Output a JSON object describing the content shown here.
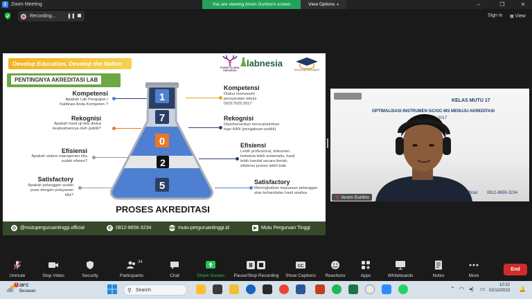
{
  "window": {
    "app_title": "Zoom Meeting",
    "viewing_banner": "You are viewing Anom Guritno's screen",
    "view_options": "View Options"
  },
  "topbar": {
    "recording_label": "Recording...",
    "sign_in": "Sign in",
    "view": "View"
  },
  "slide": {
    "banner": "Develop Education, Develop the Nation",
    "partner_logo_text": "PUMKE GLOBAL INDONESIA",
    "labnesia": "labnesia",
    "mpt_logo_text": "www.perguruantinggi.id",
    "section_title": "PENTINGNYA AKREDITASI LAB",
    "left_items": [
      {
        "title": "Kompetensi",
        "desc": "Apakah Lab Pengujian / Kalibrasi Anda Kompeten ?"
      },
      {
        "title": "Rekognisi",
        "desc": "Apakah hasil uji kita diakui keabsahannya oleh publik?"
      },
      {
        "title": "Efisiensi",
        "desc": "Apakah sistem manajemen kita sudah efisien?"
      },
      {
        "title": "Satisfactory",
        "desc": "Apakah pelanggan sudah puas dengan pelayanan kita?"
      }
    ],
    "right_items": [
      {
        "title": "Kompetensi",
        "desc": "Diakui memenuhi persyaratan teknis ISO17025:2017"
      },
      {
        "title": "Rekognisi",
        "desc": "Diperkenankan mencantumkan logo KAN (pengakuan publik)"
      },
      {
        "title": "Efisiensi",
        "desc": "Lebih profesional, dokumen terkelola lebih sistematis, hasil lebih handal secara ilmiah, efisiensi proses lebih baik"
      },
      {
        "title": "Satisfactory",
        "desc": "Meningkatkan kepuasan pelanggan atas kehandalan hasil analisa"
      }
    ],
    "flask_numbers": [
      "1",
      "7",
      "0",
      "2",
      "5"
    ],
    "flask_title": "PROSES AKREDITASI",
    "footer": {
      "instagram": "@mutuperguruantinggi.official",
      "phone": "0812-8656-3234",
      "website": "mutu-perguruantinggi.id",
      "youtube": "Mutu Perguruan Tinggi"
    },
    "colors": {
      "banner": "#f2b321",
      "green": "#6da843",
      "footer": "#37492b",
      "navy": "#2b3f66",
      "orange": "#e8782a",
      "blue": "#4f7fd0"
    }
  },
  "video": {
    "kelas": "KELAS MUTU 17",
    "optimalisasi": "OPTIMALISASI INSTRUMEN GC/GC-MS MENUJU AKREDITASI",
    "date_fragment": "2017",
    "official": "official",
    "phone": "0812-8656-3234",
    "participant_name": "Anom Guritno"
  },
  "toolbar": {
    "unmute": "Unmute",
    "stop_video": "Stop Video",
    "security": "Security",
    "participants": "Participants",
    "participants_count": "34",
    "chat": "Chat",
    "share_screen": "Share Screen",
    "pause_recording": "Pause/Stop Recording",
    "show_captions": "Show Captions",
    "reactions": "Reactions",
    "apps": "Apps",
    "whiteboards": "Whiteboards",
    "notes": "Notes",
    "more": "More",
    "end": "End"
  },
  "taskbar": {
    "temperature": "28°C",
    "weather": "Berawan",
    "search": "Search",
    "time": "10:22",
    "date": "02/12/2023",
    "notification_count": "1"
  }
}
